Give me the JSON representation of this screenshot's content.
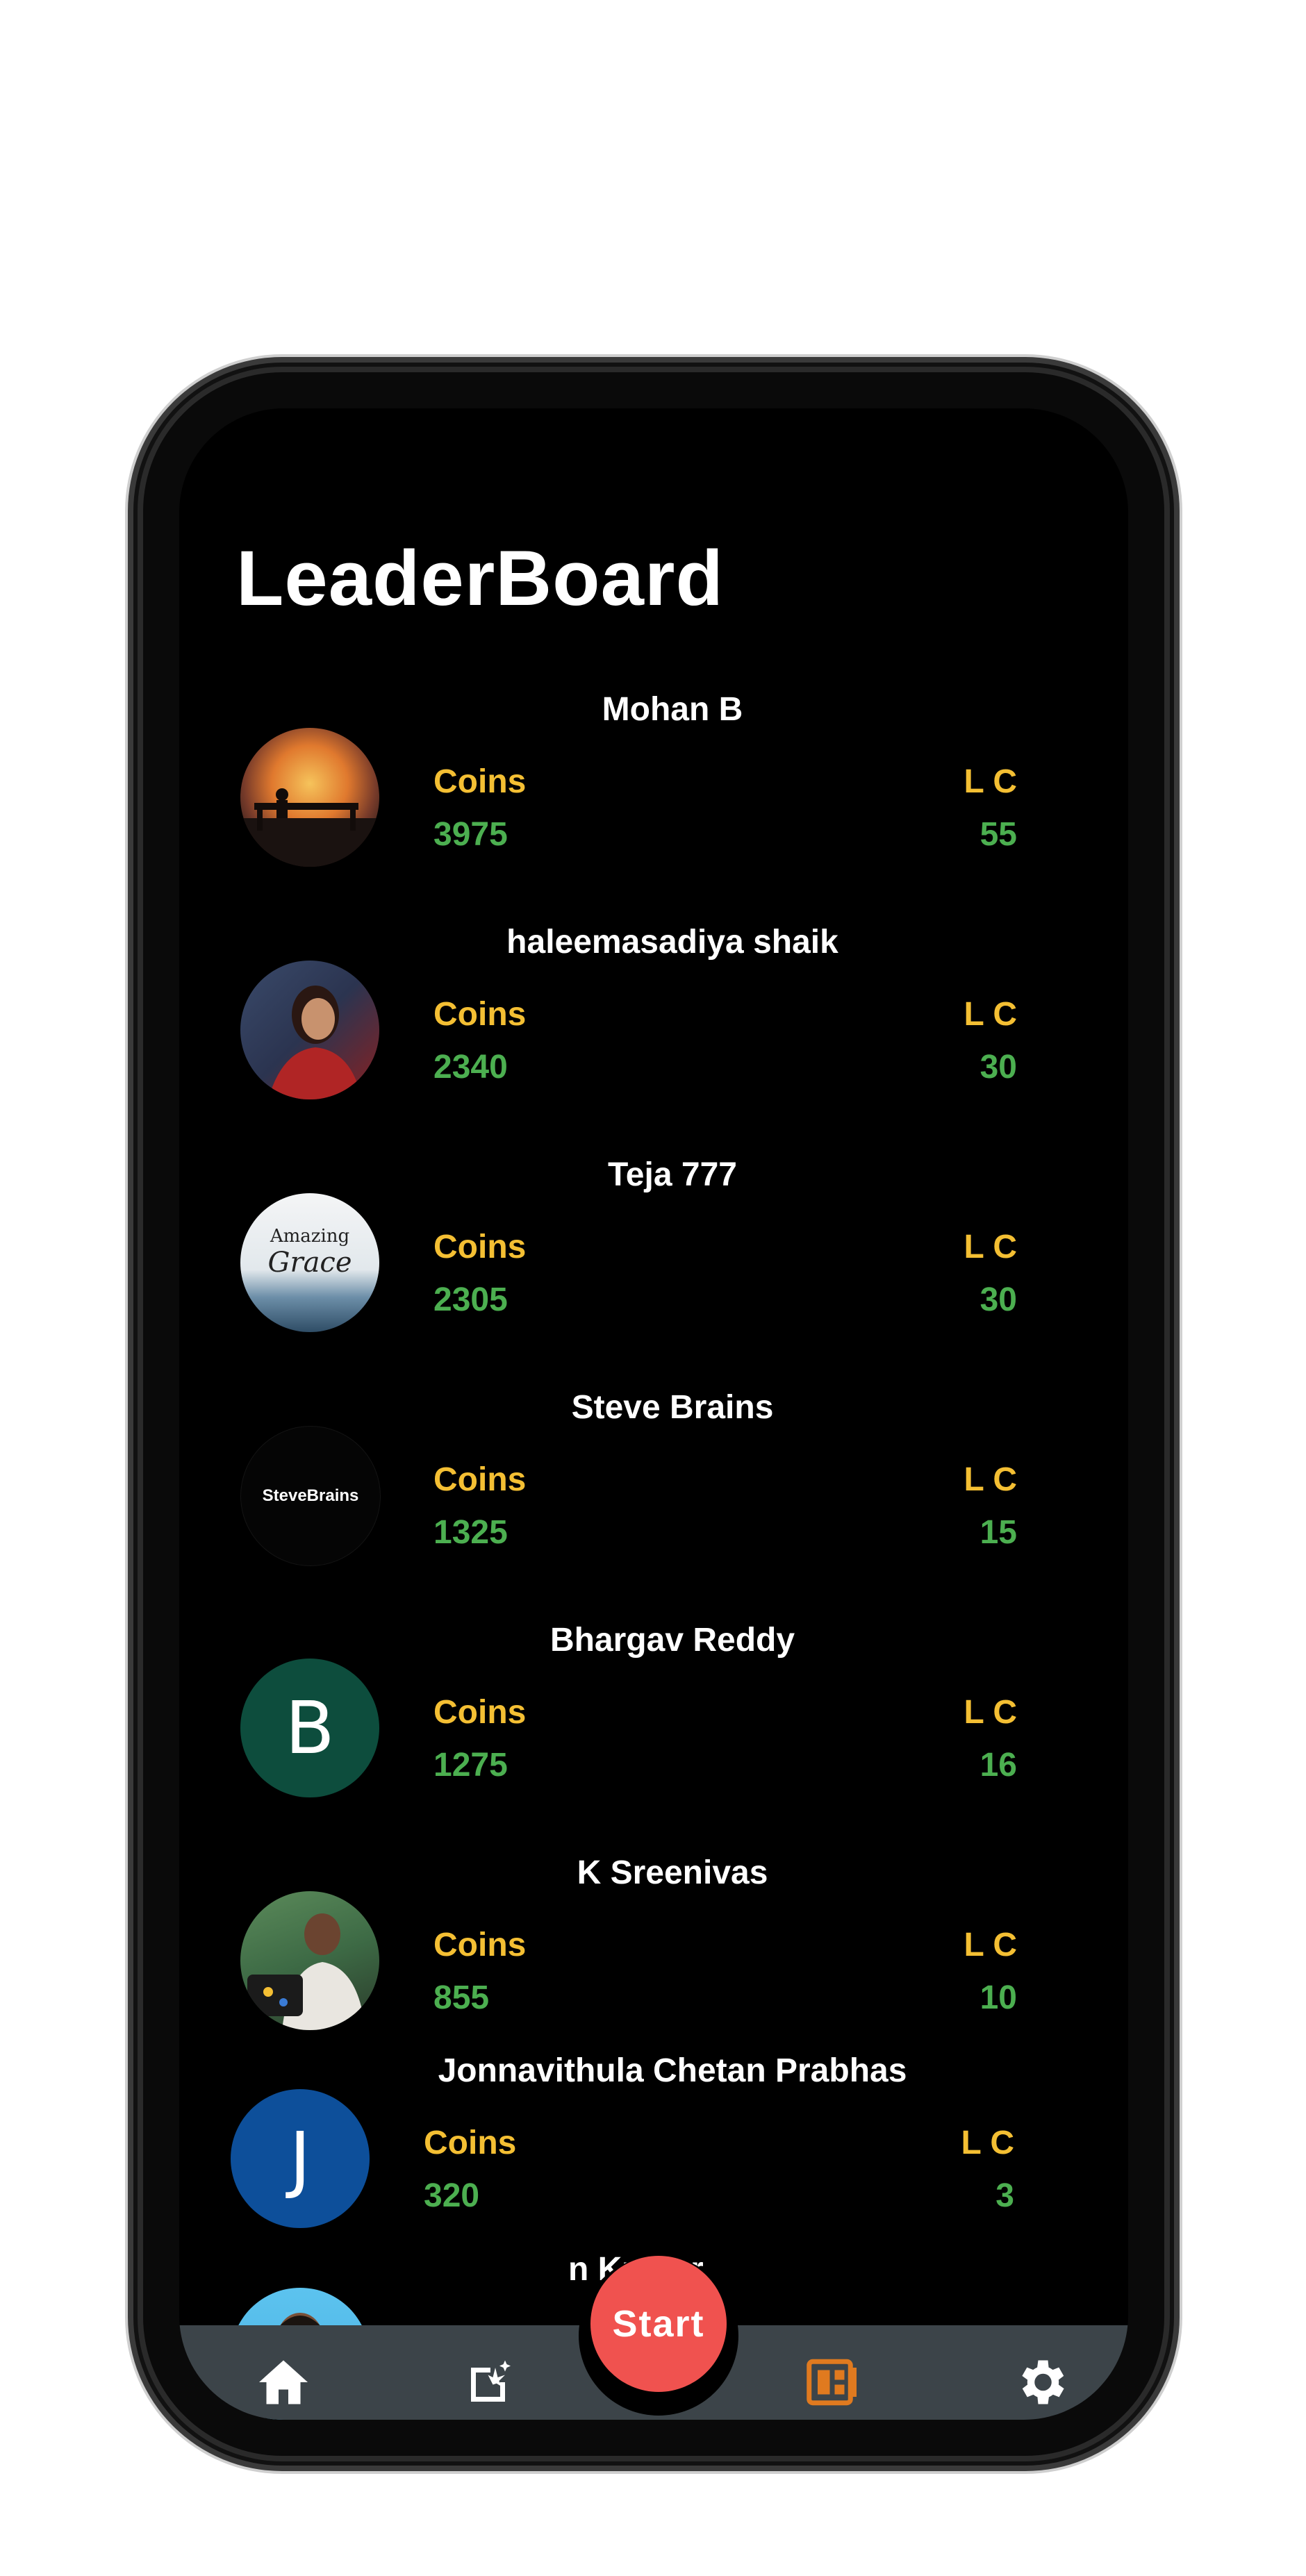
{
  "title": "LeaderBoard",
  "labels": {
    "coins": "Coins",
    "lc": "L C"
  },
  "entries": [
    {
      "name": "Mohan B",
      "coins": "3975",
      "lc": "55",
      "avatar": "sunset-bench-photo"
    },
    {
      "name": "haleemasadiya shaik",
      "coins": "2340",
      "lc": "30",
      "avatar": "portrait-photo"
    },
    {
      "name": "Teja 777",
      "coins": "2305",
      "lc": "30",
      "avatar": "amazing-grace-photo",
      "avatar_text": [
        "Amazing",
        "Grace"
      ]
    },
    {
      "name": "Steve Brains",
      "coins": "1325",
      "lc": "15",
      "avatar": "stevebrains-logo",
      "avatar_text": "SteveBrains"
    },
    {
      "name": "Bhargav Reddy",
      "coins": "1275",
      "lc": "16",
      "avatar": "letter-avatar",
      "initial": "B",
      "color": "#0d4d3d"
    },
    {
      "name": "K Sreenivas",
      "coins": "855",
      "lc": "10",
      "avatar": "portrait-photo"
    },
    {
      "name": "Jonnavithula Chetan Prabhas",
      "coins": "320",
      "lc": "3",
      "avatar": "letter-avatar",
      "initial": "J",
      "color": "#0d4f9a"
    },
    {
      "name": "n Kumar",
      "avatar": "portrait-photo-partial"
    }
  ],
  "start_label": "Start",
  "nav": [
    {
      "icon": "home-icon",
      "active": false
    },
    {
      "icon": "sparkle-edit-icon",
      "active": false
    },
    {
      "icon": "leaderboard-icon",
      "active": true
    },
    {
      "icon": "settings-icon",
      "active": false
    }
  ],
  "colors": {
    "gold": "#f4bf33",
    "green": "#4caf50",
    "start": "#f0524f",
    "bar": "#3c4449",
    "active": "#e07a1f"
  }
}
